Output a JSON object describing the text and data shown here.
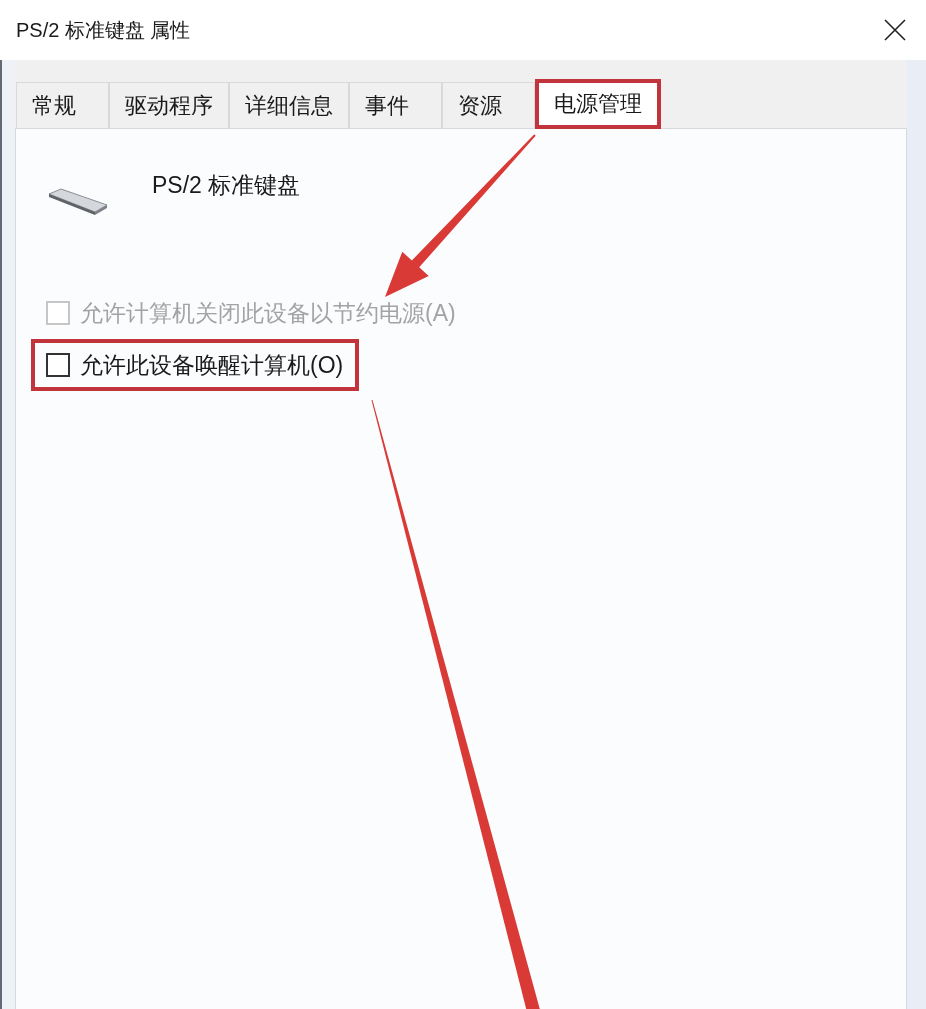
{
  "window": {
    "title": "PS/2 标准键盘 属性"
  },
  "tabs": [
    {
      "label": "常规",
      "selected": false,
      "highlighted": false
    },
    {
      "label": "驱动程序",
      "selected": false,
      "highlighted": false
    },
    {
      "label": "详细信息",
      "selected": false,
      "highlighted": false
    },
    {
      "label": "事件",
      "selected": false,
      "highlighted": false
    },
    {
      "label": "资源",
      "selected": false,
      "highlighted": false
    },
    {
      "label": "电源管理",
      "selected": true,
      "highlighted": true
    }
  ],
  "device": {
    "name": "PS/2 标准键盘"
  },
  "options": [
    {
      "label": "允许计算机关闭此设备以节约电源(A)",
      "checked": false,
      "disabled": true,
      "highlighted": false
    },
    {
      "label": "允许此设备唤醒计算机(O)",
      "checked": false,
      "disabled": false,
      "highlighted": true
    }
  ]
}
